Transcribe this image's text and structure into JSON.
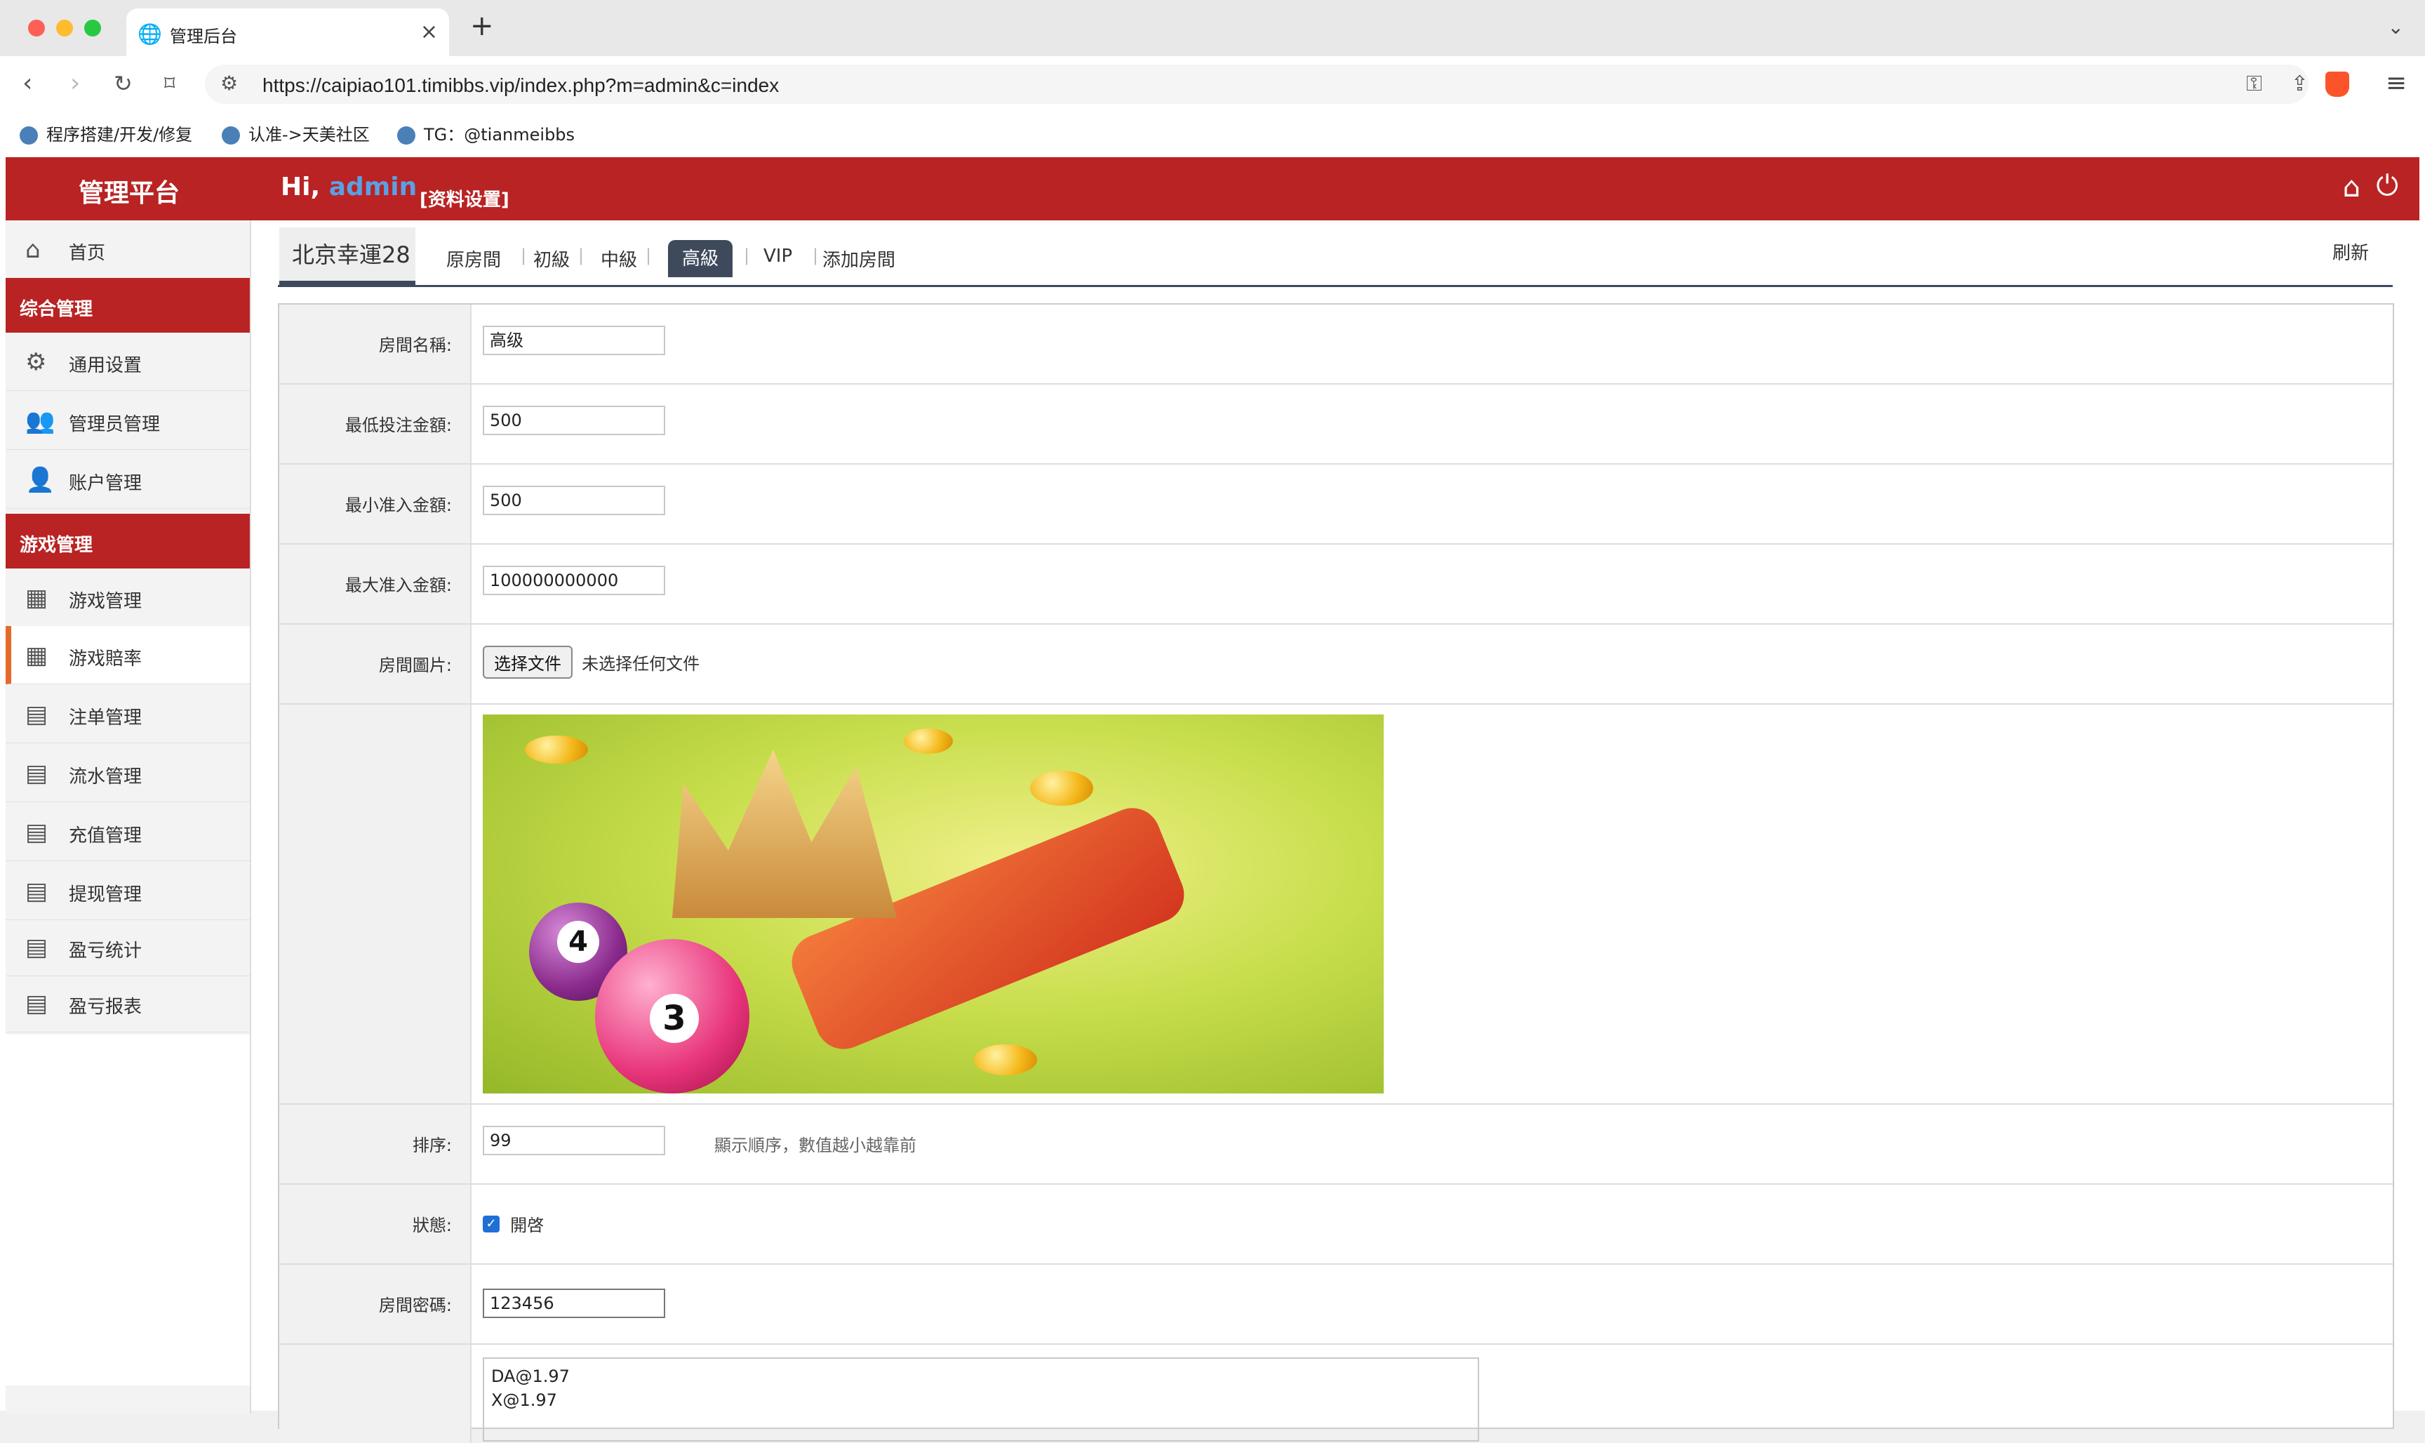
{
  "browser": {
    "tab_title": "管理后台",
    "url": "https://caipiao101.timibbs.vip/index.php?m=admin&c=index",
    "bookmarks": [
      "程序搭建/开发/修复",
      "认准->天美社区",
      "TG：@tianmeibbs"
    ]
  },
  "header": {
    "brand": "管理平台",
    "greeting": "Hi,",
    "username": "admin",
    "profile_link": "[资料设置]"
  },
  "sidebar": {
    "home": "首页",
    "group1": "综合管理",
    "group1_items": [
      "通用设置",
      "管理员管理",
      "账户管理"
    ],
    "group2": "游戏管理",
    "group2_items": [
      "游戏管理",
      "游戏賠率",
      "注单管理",
      "流水管理",
      "充值管理",
      "提现管理",
      "盈亏统计",
      "盈亏报表"
    ]
  },
  "content": {
    "game_title": "北京幸運28",
    "tabs": [
      "原房間",
      "初級",
      "中級",
      "高級",
      "VIP",
      "添加房間"
    ],
    "refresh": "刷新"
  },
  "form": {
    "room_name_label": "房間名稱:",
    "room_name_value": "高级",
    "min_bet_label": "最低投注金額:",
    "min_bet_value": "500",
    "min_entry_label": "最小准入金額:",
    "min_entry_value": "500",
    "max_entry_label": "最大准入金額:",
    "max_entry_value": "100000000000",
    "image_label": "房間圖片:",
    "file_button": "选择文件",
    "file_status": "未选择任何文件",
    "sort_label": "排序:",
    "sort_value": "99",
    "sort_hint": "顯示順序，數值越小越靠前",
    "status_label": "狀態:",
    "status_option": "開啓",
    "password_label": "房間密碼:",
    "password_value": "123456",
    "odds_lines": [
      "DA@1.97",
      "X@1.97"
    ]
  }
}
